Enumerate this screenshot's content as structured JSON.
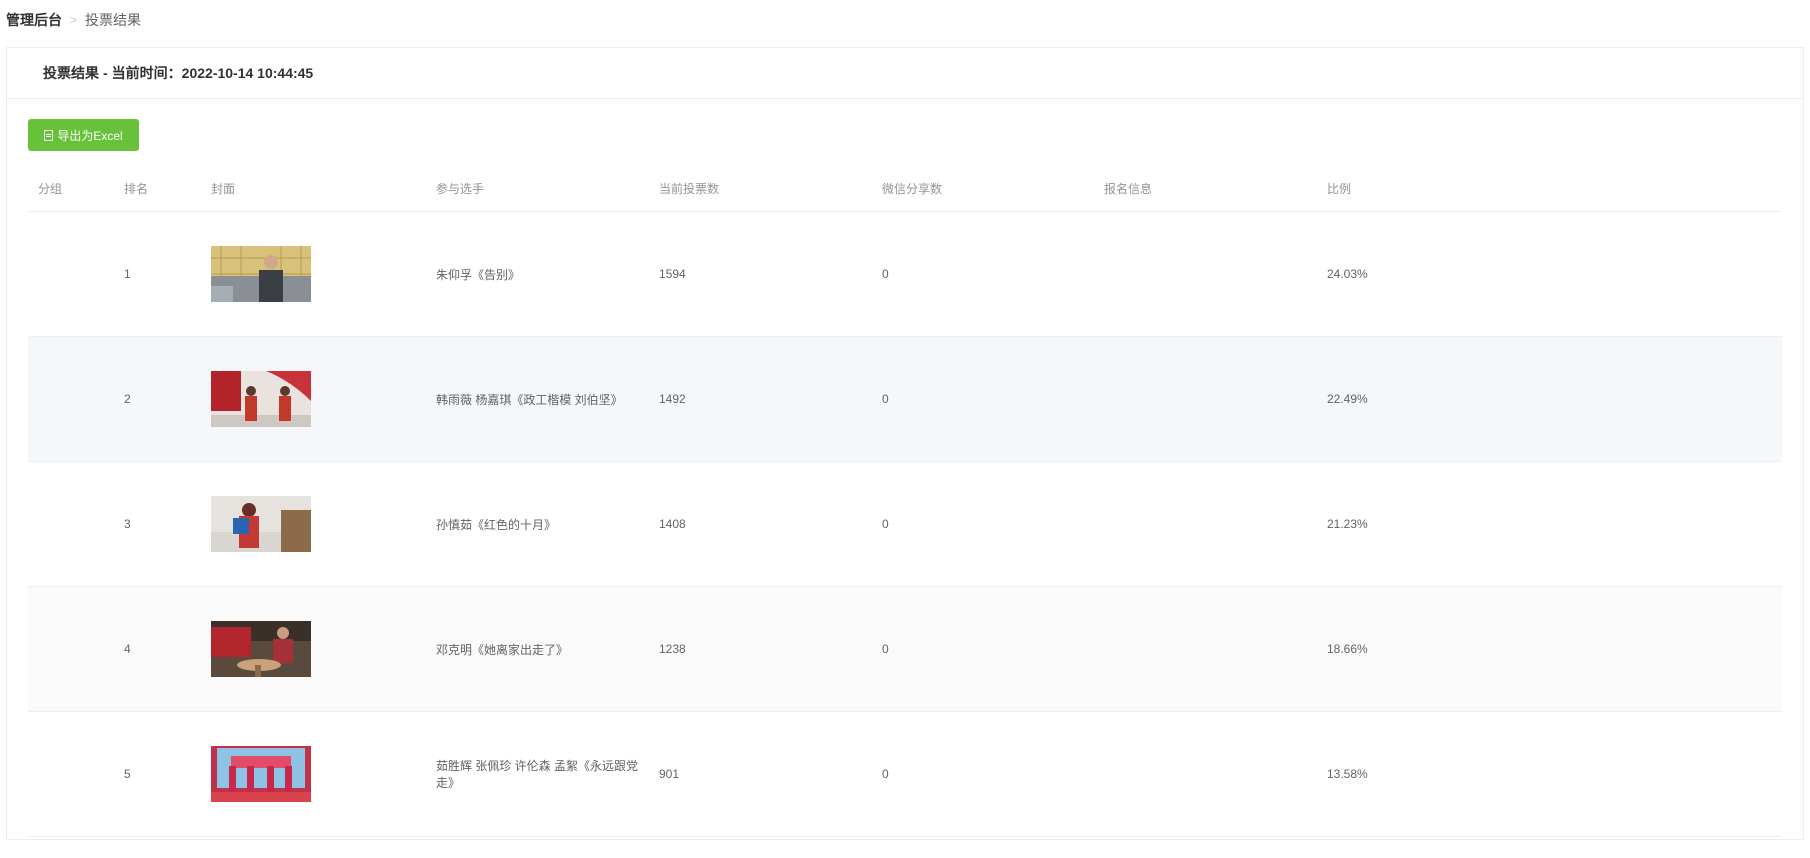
{
  "breadcrumb": {
    "home": "管理后台",
    "current": "投票结果"
  },
  "header": {
    "title": "投票结果",
    "separator": "-",
    "time_label": "当前时间：",
    "time_value": "2022-10-14 10:44:45"
  },
  "toolbar": {
    "export_label": "导出为Excel",
    "export_icon": "file-excel-icon",
    "accent": "#67c23a"
  },
  "table": {
    "columns": [
      "分组",
      "排名",
      "封面",
      "参与选手",
      "当前投票数",
      "微信分享数",
      "报名信息",
      "比例"
    ],
    "rows": [
      {
        "group": "",
        "rank": "1",
        "name": "朱仰孚《告别》",
        "votes": "1594",
        "shares": "0",
        "info": "",
        "ratio": "24.03%"
      },
      {
        "group": "",
        "rank": "2",
        "name": "韩雨薇 杨嘉琪《政工楷模 刘伯坚》",
        "votes": "1492",
        "shares": "0",
        "info": "",
        "ratio": "22.49%"
      },
      {
        "group": "",
        "rank": "3",
        "name": "孙慎茹《红色的十月》",
        "votes": "1408",
        "shares": "0",
        "info": "",
        "ratio": "21.23%"
      },
      {
        "group": "",
        "rank": "4",
        "name": "邓克明《她离家出走了》",
        "votes": "1238",
        "shares": "0",
        "info": "",
        "ratio": "18.66%"
      },
      {
        "group": "",
        "rank": "5",
        "name": "茹胜辉 张佩珍 许伦森 孟絮《永远跟党走》",
        "votes": "901",
        "shares": "0",
        "info": "",
        "ratio": "13.58%"
      }
    ]
  }
}
